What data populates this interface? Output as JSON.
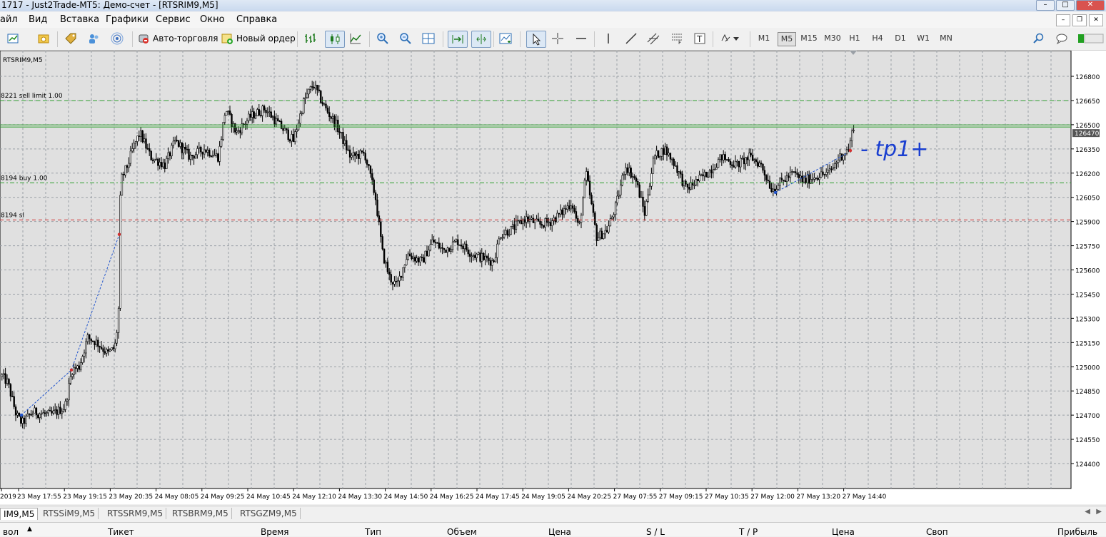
{
  "window": {
    "title": "1717 - Just2Trade-MT5: Демо-счет - [RTSRIM9,M5]"
  },
  "menu": [
    "айл",
    "Вид",
    "Вставка",
    "Графики",
    "Сервис",
    "Окно",
    "Справка"
  ],
  "toolbar": {
    "autotrading_label": "Авто-торговля",
    "new_order_label": "Новый ордер",
    "timeframes": [
      "M1",
      "M5",
      "M15",
      "M30",
      "H1",
      "H4",
      "D1",
      "W1",
      "MN"
    ],
    "active_timeframe": "M5"
  },
  "chart": {
    "symbol_label": "RTSRIM9,M5",
    "current_price": "126470",
    "price_axis": [
      "126800",
      "126650",
      "126500",
      "126350",
      "126200",
      "126050",
      "125900",
      "125750",
      "125600",
      "125450",
      "125300",
      "125150",
      "125000",
      "124850",
      "124700",
      "124550",
      "124400"
    ],
    "time_axis": [
      "2019",
      "23 May 17:55",
      "23 May 19:15",
      "23 May 20:35",
      "24 May 08:05",
      "24 May 09:25",
      "24 May 10:45",
      "24 May 12:10",
      "24 May 13:30",
      "24 May 14:50",
      "24 May 16:25",
      "24 May 17:45",
      "24 May 19:05",
      "24 May 20:25",
      "27 May 07:55",
      "27 May 09:15",
      "27 May 10:35",
      "27 May 12:00",
      "27 May 13:20",
      "27 May 14:40"
    ],
    "levels": [
      {
        "label": "8221 sell limit 1.00",
        "price": 126650,
        "color": "#2e9e2e",
        "dash": "6,4"
      },
      {
        "label": "8194 buy 1.00",
        "price": 126140,
        "color": "#2e9e2e",
        "dash": "6,3,2,3"
      },
      {
        "label": "8194 sl",
        "price": 125910,
        "color": "#d23030",
        "dash": "5,4"
      }
    ],
    "bid_line": {
      "price": 126490,
      "color": "#2e9e2e"
    },
    "annotation": "- tp1+",
    "colors": {
      "candle": "#000000",
      "grid": "#9aa0a6",
      "trade_line": "#2255cc",
      "annotation": "#1a3fd0"
    }
  },
  "tabs": [
    "IM9,M5",
    "RTSSiM9,M5",
    "RTSSRM9,M5",
    "RTSBRM9,M5",
    "RTSGZM9,M5"
  ],
  "trade_columns": [
    "вол",
    "Тикет",
    "Время",
    "Тип",
    "Объем",
    "Цена",
    "S / L",
    "T / P",
    "Цена",
    "Своп",
    "Прибыль"
  ]
}
